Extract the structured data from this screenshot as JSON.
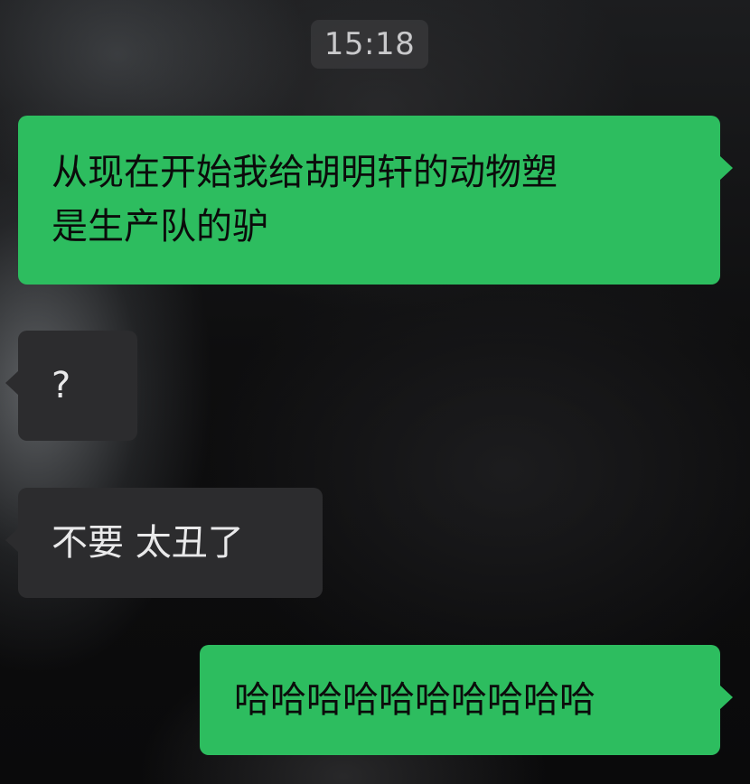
{
  "chat": {
    "timestamp": "15:18",
    "messages": [
      {
        "direction": "outgoing",
        "text": "从现在开始我给胡明轩的动物塑\n是生产队的驴"
      },
      {
        "direction": "incoming",
        "text": "?"
      },
      {
        "direction": "incoming",
        "text": "不要 太丑了"
      },
      {
        "direction": "outgoing",
        "text": "哈哈哈哈哈哈哈哈哈哈"
      }
    ]
  },
  "colors": {
    "outgoing_bubble": "#2dbd5f",
    "incoming_bubble": "#2c2c2e",
    "timestamp_pill": "#3a3a3c"
  }
}
